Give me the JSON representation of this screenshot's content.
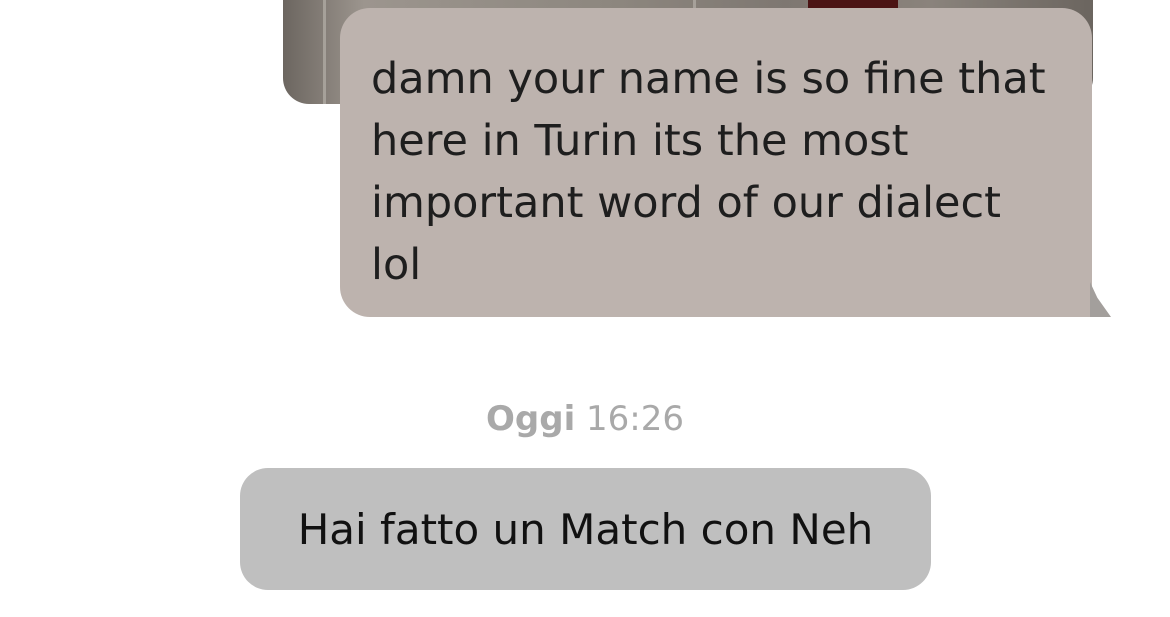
{
  "conversation": {
    "outgoing_message": {
      "text": "damn your name is so fine that here in Turin its the most important word of our dialect lol",
      "bubble_color": "#bdb3ae"
    },
    "date_separator": {
      "day": "Oggi",
      "time": "16:26"
    },
    "system_notice": {
      "text": "Hai fatto un Match con Neh",
      "pill_color": "#bfbfbf"
    }
  }
}
